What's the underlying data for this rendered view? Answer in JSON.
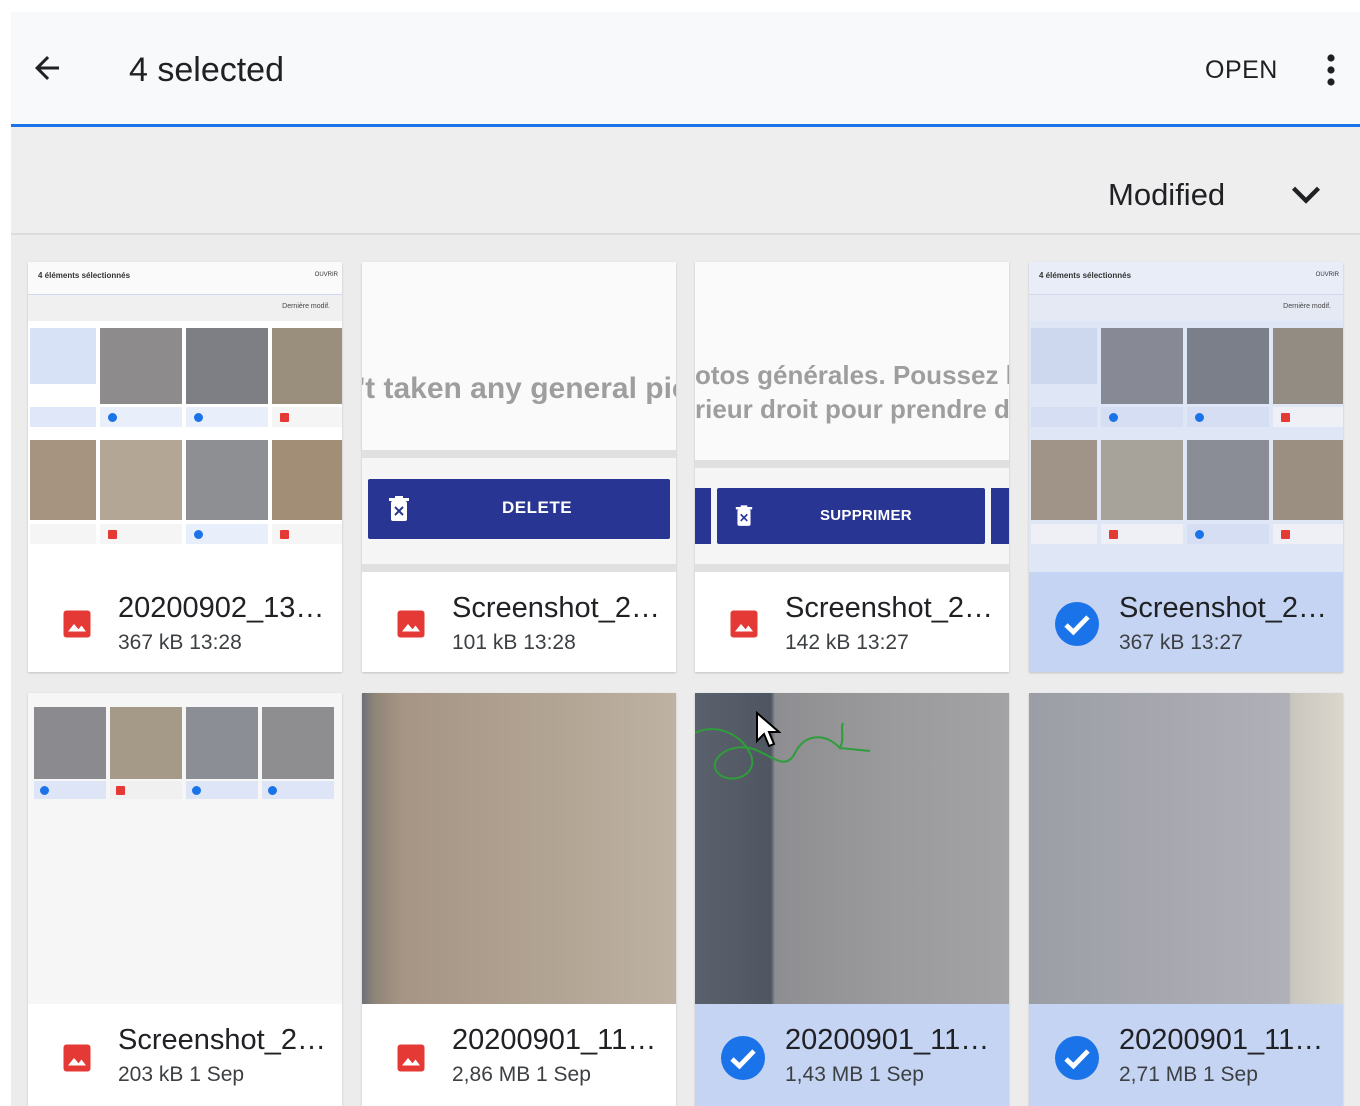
{
  "appbar": {
    "title": "4 selected",
    "open_label": "OPEN"
  },
  "sort": {
    "label": "Modified"
  },
  "colors": {
    "accent": "#1a73e8",
    "selected_bg": "#c5d4f3",
    "image_icon": "#e53935",
    "check": "#1a73e8"
  },
  "thumbs": {
    "mini_header": "4 éléments sélectionnés",
    "mini_action": "OUVRIR",
    "mini_sort": "Dernière modif.",
    "t2_text": "'t taken any general pic",
    "t2_button": "DELETE",
    "t3_text1": "otos générales. Poussez l",
    "t3_text2": "rieur droit pour prendre de",
    "t3_button": "SUPPRIMER"
  },
  "files": [
    {
      "name": "20200902_13…",
      "info": "367 kB 13:28",
      "selected": false
    },
    {
      "name": "Screenshot_2…",
      "info": "101 kB 13:28",
      "selected": false
    },
    {
      "name": "Screenshot_2…",
      "info": "142 kB 13:27",
      "selected": false
    },
    {
      "name": "Screenshot_2…",
      "info": "367 kB 13:27",
      "selected": true
    },
    {
      "name": "Screenshot_2…",
      "info": "203 kB 1 Sep",
      "selected": false
    },
    {
      "name": "20200901_11…",
      "info": "2,86 MB 1 Sep",
      "selected": false
    },
    {
      "name": "20200901_11…",
      "info": "1,43 MB 1 Sep",
      "selected": true
    },
    {
      "name": "20200901_11…",
      "info": "2,71 MB 1 Sep",
      "selected": true
    }
  ]
}
